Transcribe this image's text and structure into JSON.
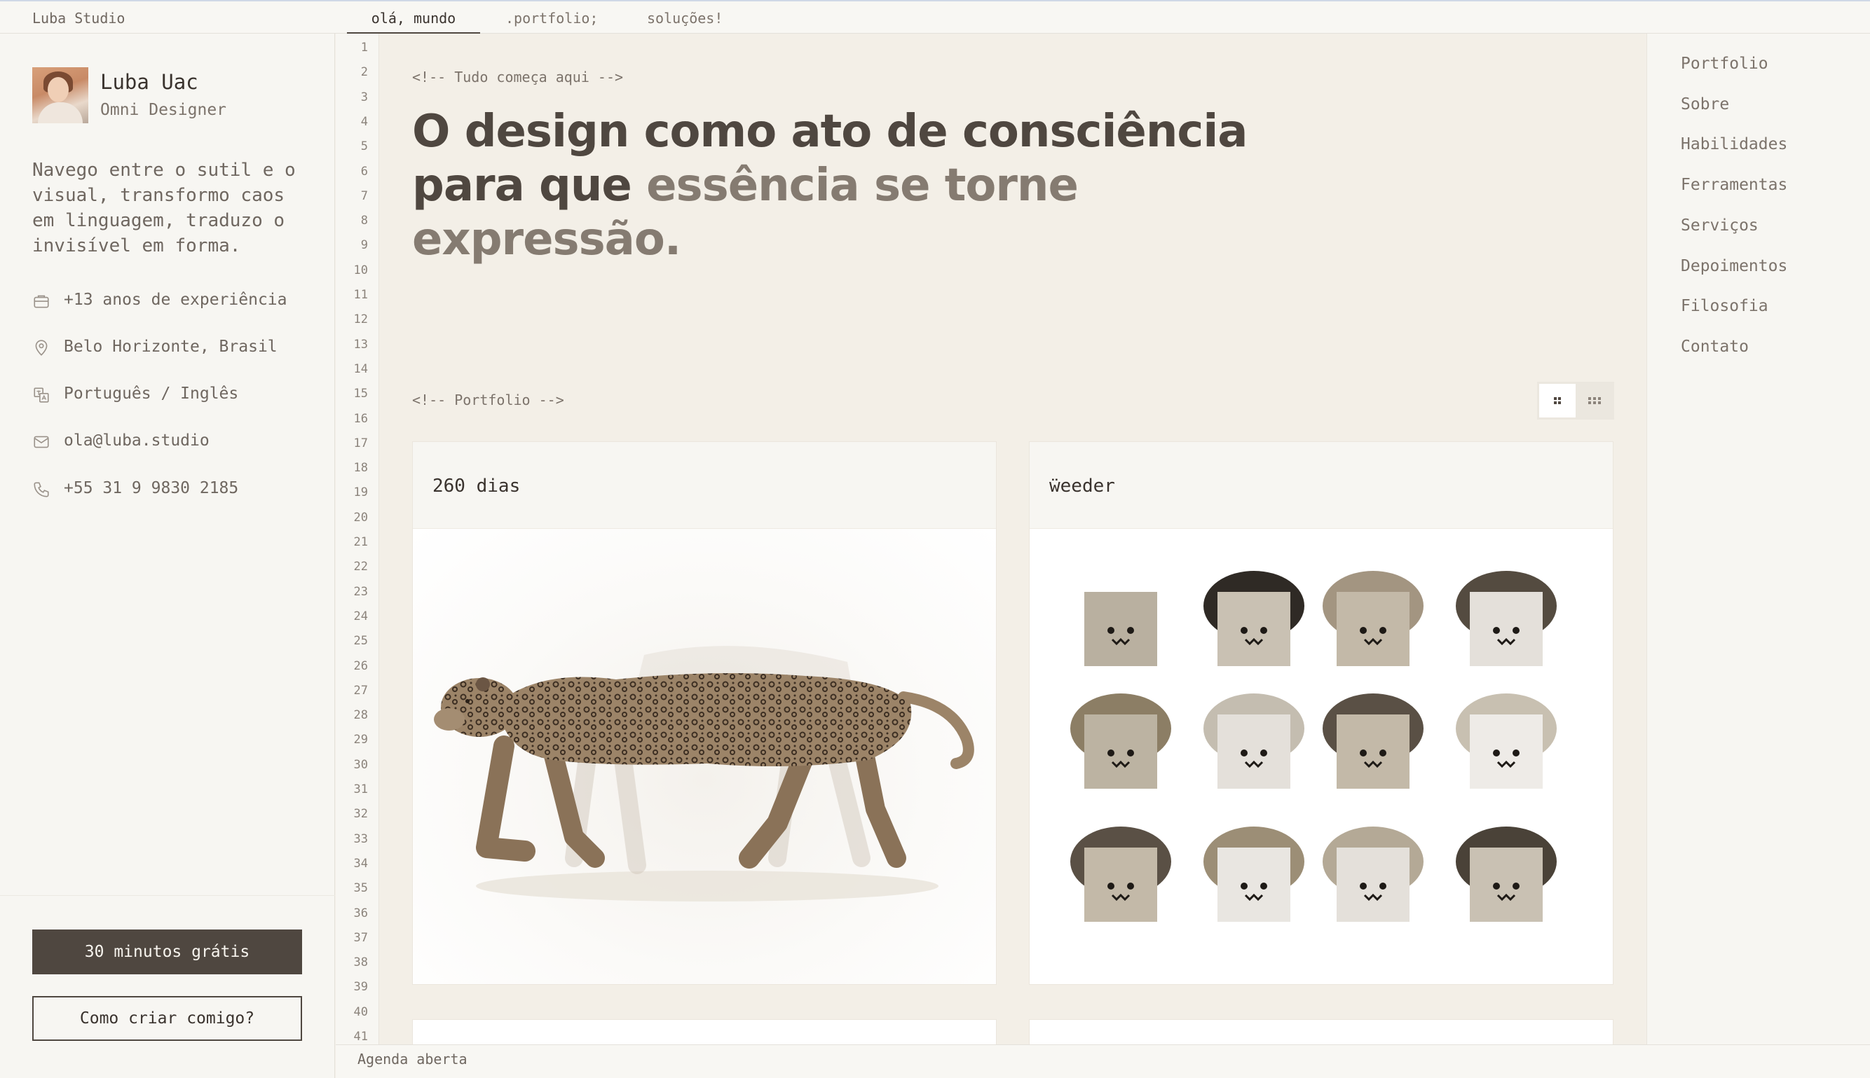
{
  "brand": "Luba Studio",
  "tabs": [
    {
      "label": "olá, mundo",
      "active": true
    },
    {
      "label": ".portfolio;",
      "active": false
    },
    {
      "label": "soluções!",
      "active": false
    }
  ],
  "profile": {
    "name": "Luba Uac",
    "role": "Omni Designer",
    "bio": "Navego entre o sutil e o visual, transformo caos em linguagem, traduzo o invisível em forma."
  },
  "info": [
    {
      "icon": "briefcase-icon",
      "text": "+13 anos de experiência"
    },
    {
      "icon": "location-pin-icon",
      "text": "Belo Horizonte, Brasil"
    },
    {
      "icon": "translate-icon",
      "text": "Português / Inglês"
    },
    {
      "icon": "mail-icon",
      "text": "ola@luba.studio"
    },
    {
      "icon": "phone-icon",
      "text": "+55 31 9 9830 2185"
    }
  ],
  "cta": {
    "primary": "30 minutos grátis",
    "secondary": "Como criar comigo?"
  },
  "line_numbers": [
    "1",
    "2",
    "3",
    "4",
    "5",
    "6",
    "7",
    "8",
    "9",
    "10",
    "11",
    "12",
    "13",
    "14",
    "15",
    "16",
    "17",
    "18",
    "19",
    "20",
    "21",
    "22",
    "23",
    "24",
    "25",
    "26",
    "27",
    "28",
    "29",
    "30",
    "31",
    "32",
    "33",
    "34",
    "35",
    "36",
    "37",
    "38",
    "39",
    "40",
    "41"
  ],
  "main": {
    "intro_comment": "<!-- Tudo começa aqui -->",
    "hero_line1": "O design como ato de consciência",
    "hero_line2_dark": "para que ",
    "hero_line2_muted": "essência se torne",
    "hero_line3_muted": "expressão.",
    "portfolio_comment": "<!-- Portfolio -->",
    "cards": [
      {
        "title": "260 dias",
        "image": "leopard-image"
      },
      {
        "title": "ẅeeder",
        "image": "avatars-grid-image"
      }
    ]
  },
  "nav": [
    "Portfolio",
    "Sobre",
    "Habilidades",
    "Ferramentas",
    "Serviços",
    "Depoimentos",
    "Filosofia",
    "Contato"
  ],
  "status": "Agenda aberta",
  "colors": {
    "dark": "#4f4740",
    "muted": "#857b71",
    "background": "#f3efe7",
    "sidebar": "#f7f6f2"
  }
}
